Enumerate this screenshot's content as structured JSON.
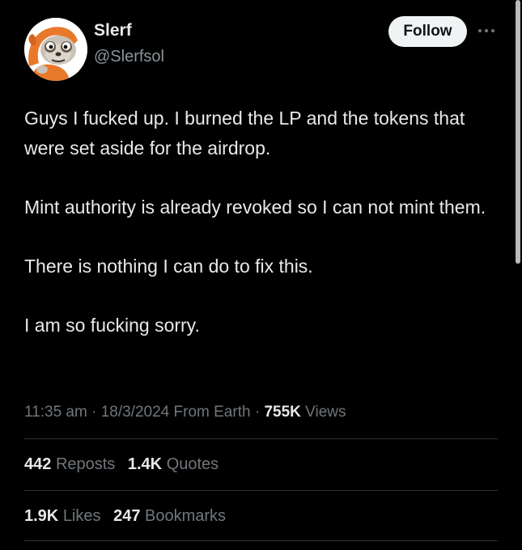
{
  "author": {
    "display_name": "Slerf",
    "handle": "@Slerfsol",
    "avatar_icon": "sloth-avatar"
  },
  "header": {
    "follow_label": "Follow",
    "more_icon": "more-dots-icon"
  },
  "tweet": {
    "paragraphs": [
      "Guys I fucked up. I burned the LP and the tokens that were set aside for the airdrop.",
      "Mint authority is already revoked so I can not mint them.",
      "There is nothing I can do to fix this.",
      "I am so fucking sorry."
    ]
  },
  "meta": {
    "time": "11:35 am",
    "separator": "·",
    "date": "18/3/2024",
    "source": "From Earth",
    "views_count": "755K",
    "views_label": "Views"
  },
  "stats": {
    "reposts_count": "442",
    "reposts_label": "Reposts",
    "quotes_count": "1.4K",
    "quotes_label": "Quotes",
    "likes_count": "1.9K",
    "likes_label": "Likes",
    "bookmarks_count": "247",
    "bookmarks_label": "Bookmarks"
  },
  "colors": {
    "background": "#000000",
    "text_primary": "#e7e9ea",
    "text_secondary": "#71767b",
    "follow_bg": "#eff3f4",
    "divider": "#2f3336",
    "avatar_accent": "#e8792b"
  }
}
